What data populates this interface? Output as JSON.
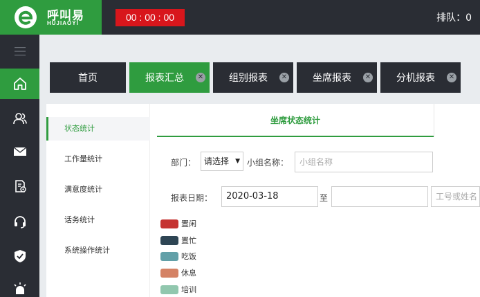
{
  "header": {
    "logo_cn": "呼叫易",
    "logo_en": "HUJIAOYI",
    "timer": "00 : 00 : 00",
    "queue": "排队：0"
  },
  "nav": {
    "items": [
      {
        "name": "menu-toggle-icon"
      },
      {
        "name": "home-icon"
      },
      {
        "name": "users-icon"
      },
      {
        "name": "mail-icon"
      },
      {
        "name": "report-settings-icon"
      },
      {
        "name": "headset-icon"
      },
      {
        "name": "shield-check-icon"
      },
      {
        "name": "alarm-icon"
      }
    ]
  },
  "tabs": [
    {
      "label": "首页",
      "active": false,
      "closable": false
    },
    {
      "label": "报表汇总",
      "active": true,
      "closable": true
    },
    {
      "label": "组别报表",
      "active": false,
      "closable": true
    },
    {
      "label": "坐席报表",
      "active": false,
      "closable": true
    },
    {
      "label": "分机报表",
      "active": false,
      "closable": true
    }
  ],
  "submenu": [
    {
      "label": "状态统计",
      "active": true
    },
    {
      "label": "工作量统计",
      "active": false
    },
    {
      "label": "满意度统计",
      "active": false
    },
    {
      "label": "话务统计",
      "active": false
    },
    {
      "label": "系统操作统计",
      "active": false
    }
  ],
  "main": {
    "tab_title": "坐席状态统计",
    "dept_label": "部门：",
    "dept_select": "请选择",
    "group_label": "小组名称：",
    "group_placeholder": "小组名称",
    "date_label": "报表日期：",
    "date_from": "2020-03-18",
    "date_to_label": "至",
    "date_to": "",
    "agent_placeholder": "工号或姓名"
  },
  "legend": [
    {
      "label": "置闲",
      "color": "#c53331"
    },
    {
      "label": "置忙",
      "color": "#2e4554"
    },
    {
      "label": "吃饭",
      "color": "#62a0a8"
    },
    {
      "label": "休息",
      "color": "#d48265"
    },
    {
      "label": "培训",
      "color": "#91c7ae"
    }
  ]
}
